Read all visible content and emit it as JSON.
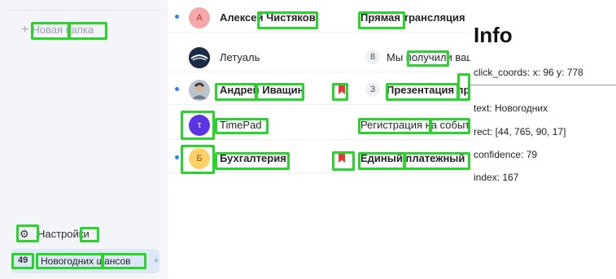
{
  "sidebar": {
    "new_folder_label": "Новая папка",
    "settings_label": "Настройки",
    "active_folder": {
      "count": "49",
      "label": "Новогодних шансов"
    }
  },
  "mail": [
    {
      "sender": "Алексей Чистяков",
      "unread": true,
      "avatar_text": "А",
      "avatar_color": "#f6a8a8",
      "avatar_text_color": "#c0392b",
      "flag": false,
      "count": "",
      "subject": "Прямая трансляция"
    },
    {
      "sender": "Летуаль",
      "unread": false,
      "avatar_text": "",
      "avatar_color": "#1d2a44",
      "avatar_text_color": "#ffffff",
      "flag": false,
      "count": "8",
      "subject": "Мы получили ваш"
    },
    {
      "sender": "Андрей Иващин",
      "unread": true,
      "avatar_text": "",
      "avatar_color": "#b9c4cc",
      "avatar_text_color": "#ffffff",
      "flag": true,
      "count": "3",
      "subject": "Презентация проекта"
    },
    {
      "sender": "TimePad",
      "unread": false,
      "avatar_text": "τ",
      "avatar_color": "#5b34e6",
      "avatar_text_color": "#ffffff",
      "flag": false,
      "count": "",
      "subject": "Регистрация на событие"
    },
    {
      "sender": "Бухгалтерия",
      "unread": true,
      "avatar_text": "Б",
      "avatar_color": "#fbd06b",
      "avatar_text_color": "#8a5a00",
      "flag": true,
      "count": "",
      "subject": "Единый платежный"
    }
  ],
  "info": {
    "title": "Info",
    "click_coords": "click_coords: x: 96 y: 778",
    "text": "text: Новогодних",
    "rect": "rect: [44, 765, 90, 17]",
    "confidence": "confidence: 79",
    "index": "index: 167"
  },
  "colors": {
    "highlight": "#29d52a",
    "unread_dot": "#2d80f5",
    "flag": "#e53935",
    "active_folder_bg": "#dde7f6"
  }
}
